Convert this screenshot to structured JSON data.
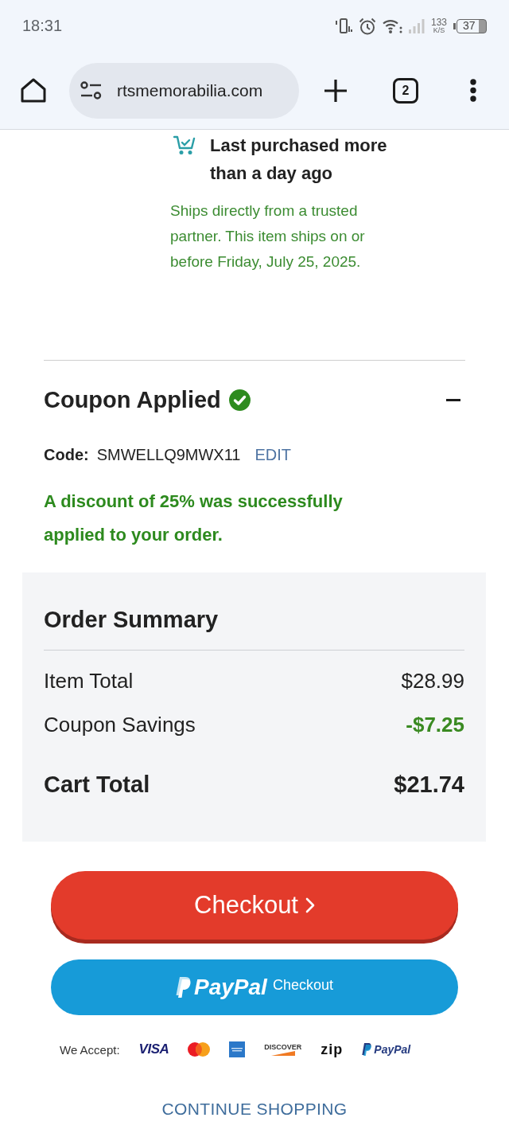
{
  "status_bar": {
    "time": "18:31",
    "speed_value": "133",
    "speed_unit": "K/S",
    "battery": "37"
  },
  "browser_bar": {
    "url": "rtsmemorabilia.com",
    "tab_count": "2"
  },
  "item": {
    "purchase_note": "Last purchased more than a day ago",
    "shipping_note": "Ships directly from a trusted partner. This item ships on or before Friday, July 25, 2025."
  },
  "coupon": {
    "title": "Coupon Applied",
    "applied": true,
    "expanded": true,
    "code_label": "Code:",
    "code": "SMWELLQ9MWX11",
    "edit_link": "EDIT",
    "message": "A discount of 25% was successfully applied to your order."
  },
  "order_summary": {
    "title": "Order Summary",
    "rows": [
      {
        "kind": "line",
        "label": "Item Total",
        "value": "$28.99"
      },
      {
        "kind": "discount",
        "label": "Coupon Savings",
        "value": "-$7.25"
      },
      {
        "kind": "total",
        "label": "Cart Total",
        "value": "$21.74"
      }
    ]
  },
  "checkout_button": {
    "label": "Checkout"
  },
  "paypal_button": {
    "brand": "PayPal",
    "label": "Checkout"
  },
  "payment_methods": {
    "label": "We Accept:",
    "logos": [
      {
        "kind": "visa",
        "text": "VISA"
      },
      {
        "kind": "mastercard"
      },
      {
        "kind": "amex"
      },
      {
        "kind": "discover",
        "text": "DISCOVER"
      },
      {
        "kind": "zip",
        "text": "zip"
      },
      {
        "kind": "paypal",
        "text": "PayPal"
      }
    ]
  },
  "continue_link": "CONTINUE SHOPPING"
}
